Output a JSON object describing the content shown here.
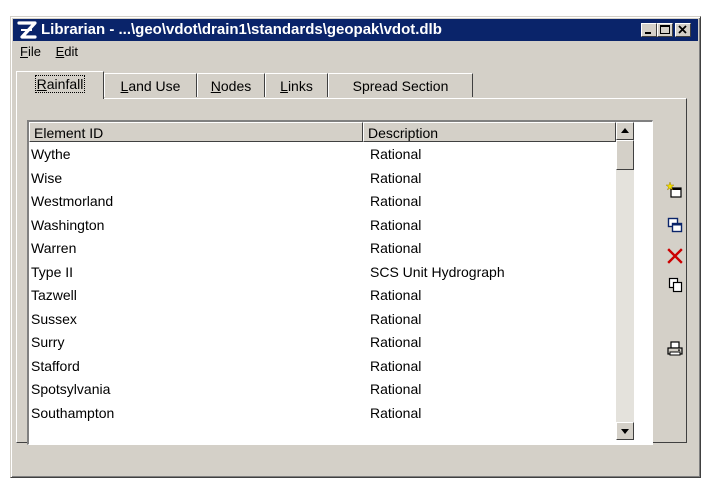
{
  "window": {
    "title": "Librarian - ...\\geo\\vdot\\drain1\\standards\\geopak\\vdot.dlb",
    "title_bar_color": "#0a246a"
  },
  "menu": [
    {
      "label_u": "F",
      "label_rest": "ile"
    },
    {
      "label_u": "E",
      "label_rest": "dit"
    }
  ],
  "tabs": [
    {
      "label_u": "R",
      "label_rest": "ainfall",
      "active": true
    },
    {
      "label_u": "L",
      "label_rest": "and Use",
      "active": false
    },
    {
      "label_u": "N",
      "label_rest": "odes",
      "active": false
    },
    {
      "label_u": "L",
      "label_rest": "inks",
      "active": false
    },
    {
      "label_u": "",
      "label_rest": "Spread Section",
      "active": false
    }
  ],
  "table": {
    "columns": [
      "Element ID",
      "Description"
    ],
    "rows": [
      [
        "Wythe",
        "Rational"
      ],
      [
        "Wise",
        "Rational"
      ],
      [
        "Westmorland",
        "Rational"
      ],
      [
        "Washington",
        "Rational"
      ],
      [
        "Warren",
        "Rational"
      ],
      [
        "Type II",
        "SCS Unit Hydrograph"
      ],
      [
        "Tazwell",
        "Rational"
      ],
      [
        "Sussex",
        "Rational"
      ],
      [
        "Surry",
        "Rational"
      ],
      [
        "Stafford",
        "Rational"
      ],
      [
        "Spotsylvania",
        "Rational"
      ],
      [
        "Southampton",
        "Rational"
      ]
    ]
  },
  "side_tools": [
    "new-item-icon",
    "copy-icon",
    "delete-icon",
    "duplicate-icon",
    "print-icon"
  ],
  "colors": {
    "delete": "#cc0000",
    "accent": "#0a246a"
  }
}
